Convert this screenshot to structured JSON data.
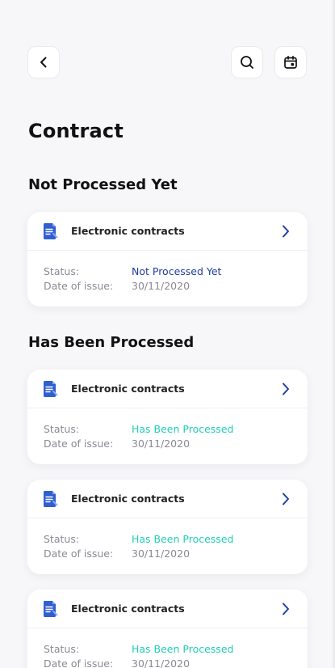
{
  "header": {
    "back_icon": "chevron-left-icon",
    "search_icon": "search-icon",
    "calendar_icon": "calendar-icon"
  },
  "page": {
    "title": "Contract"
  },
  "sections": [
    {
      "title": "Not Processed Yet",
      "cards": [
        {
          "title": "Electronic contracts",
          "status_label": "Status:",
          "status": "Not Processed Yet",
          "date_label": "Date of issue:",
          "date": "30/11/2020"
        }
      ]
    },
    {
      "title": "Has Been Processed",
      "cards": [
        {
          "title": "Electronic contracts",
          "status_label": "Status:",
          "status": "Has Been Processed",
          "date_label": "Date of issue:",
          "date": "30/11/2020"
        },
        {
          "title": "Electronic contracts",
          "status_label": "Status:",
          "status": "Has Been Processed",
          "date_label": "Date of issue:",
          "date": "30/11/2020"
        },
        {
          "title": "Electronic contracts",
          "status_label": "Status:",
          "status": "Has Been Processed",
          "date_label": "Date of issue:",
          "date": "30/11/2020"
        }
      ]
    }
  ],
  "colors": {
    "accent": "#2f5fd0",
    "status_pending": "#1f3fa0",
    "status_processed": "#1fcfb3",
    "background": "#f7f7f9"
  }
}
